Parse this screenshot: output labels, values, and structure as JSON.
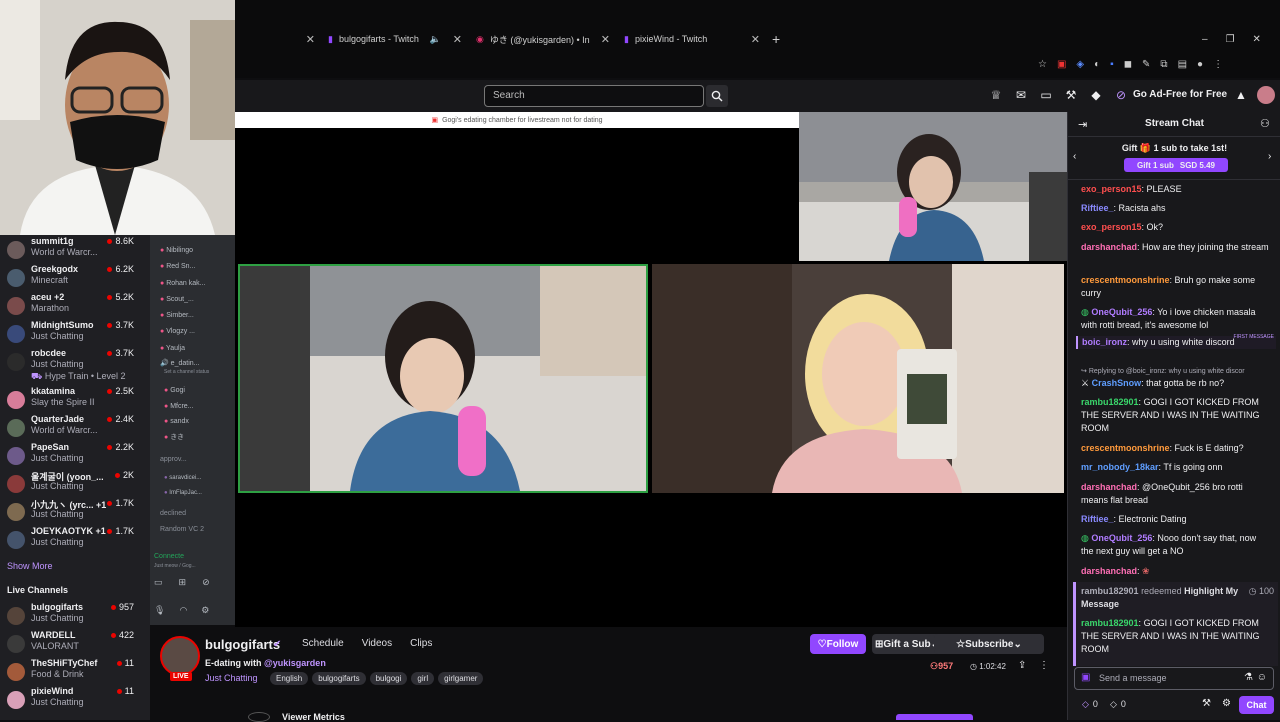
{
  "tabs": [
    {
      "label": "bulgogifarts - Twitch",
      "icon": "twitch-icon"
    },
    {
      "label": "ゆき (@yukisgarden) • Instagram",
      "icon": "instagram-icon"
    },
    {
      "label": "pixieWind - Twitch",
      "icon": "twitch-icon"
    }
  ],
  "nav": {
    "search_placeholder": "Search",
    "adfree_label": "Go Ad-Free for Free"
  },
  "banner_text": "Gogi's edating chamber for livestream not for dating",
  "sidebar": {
    "followed": [
      {
        "name": "summit1g",
        "category": "World of Warcr...",
        "viewers": "8.6K"
      },
      {
        "name": "Greekgodx",
        "category": "Minecraft",
        "viewers": "6.2K"
      },
      {
        "name": "aceu +2",
        "category": "Marathon",
        "viewers": "5.2K"
      },
      {
        "name": "MidnightSumo",
        "category": "Just Chatting",
        "viewers": "3.7K"
      },
      {
        "name": "robcdee",
        "category": "Just Chatting",
        "viewers": "3.7K",
        "extra": "Hype Train • Level 2"
      },
      {
        "name": "kkatamina",
        "category": "Slay the Spire II",
        "viewers": "2.5K"
      },
      {
        "name": "QuarterJade",
        "category": "World of Warcr...",
        "viewers": "2.4K"
      },
      {
        "name": "PapeSan",
        "category": "Just Chatting",
        "viewers": "2.2K"
      },
      {
        "name": "울계굴이 (yoon_...",
        "category": "Just Chatting",
        "viewers": "2K"
      },
      {
        "name": "小九九ヽ (yrc... +1",
        "category": "Just Chatting",
        "viewers": "1.7K"
      },
      {
        "name": "JOEYKAOTYK +1",
        "category": "Just Chatting",
        "viewers": "1.7K"
      }
    ],
    "show_more": "Show More",
    "live_heading": "Live Channels",
    "live": [
      {
        "name": "bulgogifarts",
        "category": "Just Chatting",
        "viewers": "957"
      },
      {
        "name": "WARDELL",
        "category": "VALORANT",
        "viewers": "422"
      },
      {
        "name": "TheSHiFTyChef",
        "category": "Food & Drink",
        "viewers": "11"
      },
      {
        "name": "pixieWind",
        "category": "Just Chatting",
        "viewers": "11"
      }
    ]
  },
  "discord": {
    "members": [
      "Nibilingo",
      "Red Sn...",
      "Rohan kak...",
      "Scout_...",
      "Simber...",
      "Vlogzy ...",
      "Yaulja"
    ],
    "channel": "e_datin...",
    "channel_status": "Set a channel status",
    "voice": [
      "Gogi",
      "Mfcre...",
      "sandx",
      "きき"
    ],
    "approve": "approv...",
    "approve_users": [
      "saravdicei...",
      "ImFlapJac..."
    ],
    "declined": "declined",
    "random": "Random VC 2",
    "connect": "Connecte",
    "connect_sub": "Just meow / Gog..."
  },
  "stream": {
    "channel": "bulgogifarts",
    "links": [
      "Schedule",
      "Videos",
      "Clips"
    ],
    "title": "E-dating with",
    "mention": "@yukisgarden",
    "live_badge": "LIVE",
    "category": "Just Chatting",
    "tags": [
      "English",
      "bulgogifarts",
      "bulgogi",
      "girl",
      "girlgamer"
    ],
    "viewers": "957",
    "uptime": "1:02:42",
    "follow_label": "Follow",
    "gift_label": "Gift a Sub",
    "subscribe_label": "Subscribe",
    "viewer_metrics": "Viewer Metrics"
  },
  "chat": {
    "title": "Stream Chat",
    "gift_banner": "Gift 🎁 1 sub to take 1st!",
    "gift_button": "Gift 1 sub",
    "gift_price": "SGD 5.49",
    "messages": [
      {
        "user": "exo_person15",
        "color": "#ff4f4f",
        "text": "PLEASE"
      },
      {
        "user": "Riftiee_",
        "color": "#8a8aff",
        "text": "Racista ahs"
      },
      {
        "user": "exo_person15",
        "color": "#ff4f4f",
        "text": "Ok?"
      },
      {
        "user": "darshanchad",
        "color": "#ff6fb5",
        "text": "How are they joining the stream"
      },
      {
        "user": "crescentmoonshrine",
        "color": "#ff9a3c",
        "text": "Bruh go make some curry"
      },
      {
        "user": "OneQubit_256",
        "color": "#b07cff",
        "text": "Yo i love chicken masala with rotti bread, it's awesome lol"
      },
      {
        "user": "boic_ironz",
        "color": "#b07cff",
        "text": "why u using white discord",
        "first": "FIRST MESSAGE"
      },
      {
        "reply": "Replying to @boic_ironz: why u using white discor",
        "user": "CrashSnow",
        "color": "#5f9eff",
        "text": "that gotta be rb no?"
      },
      {
        "user": "rambu182901",
        "color": "#3ad66b",
        "text": "GOGI I GOT KICKED FROM THE SERVER AND I WAS IN THE WAITING ROOM"
      },
      {
        "user": "crescentmoonshrine",
        "color": "#ff9a3c",
        "text": "Fuck is E dating?"
      },
      {
        "user": "mr_nobody_18kar",
        "color": "#5f9eff",
        "text": "Tf is going onn"
      },
      {
        "user": "darshanchad",
        "color": "#ff6fb5",
        "text": "@OneQubit_256 bro rotti means flat bread"
      },
      {
        "user": "Riftiee_",
        "color": "#8a8aff",
        "text": "Electronic Dating"
      },
      {
        "user": "OneQubit_256",
        "color": "#b07cff",
        "text": "Nooo don't say that, now the next guy will get a NO"
      },
      {
        "user": "darshanchad",
        "color": "#ff6fb5",
        "text": ""
      }
    ],
    "redeem": {
      "user": "rambu182901",
      "action": "redeemed",
      "reward": "Highlight My Message",
      "cost": "100"
    },
    "highlight": {
      "user": "rambu182901",
      "text": "GOGI I GOT KICKED FROM THE SERVER AND I WAS IN THE WAITING ROOM"
    },
    "input_placeholder": "Send a message",
    "points_a": "0",
    "points_b": "0",
    "chat_button": "Chat"
  }
}
